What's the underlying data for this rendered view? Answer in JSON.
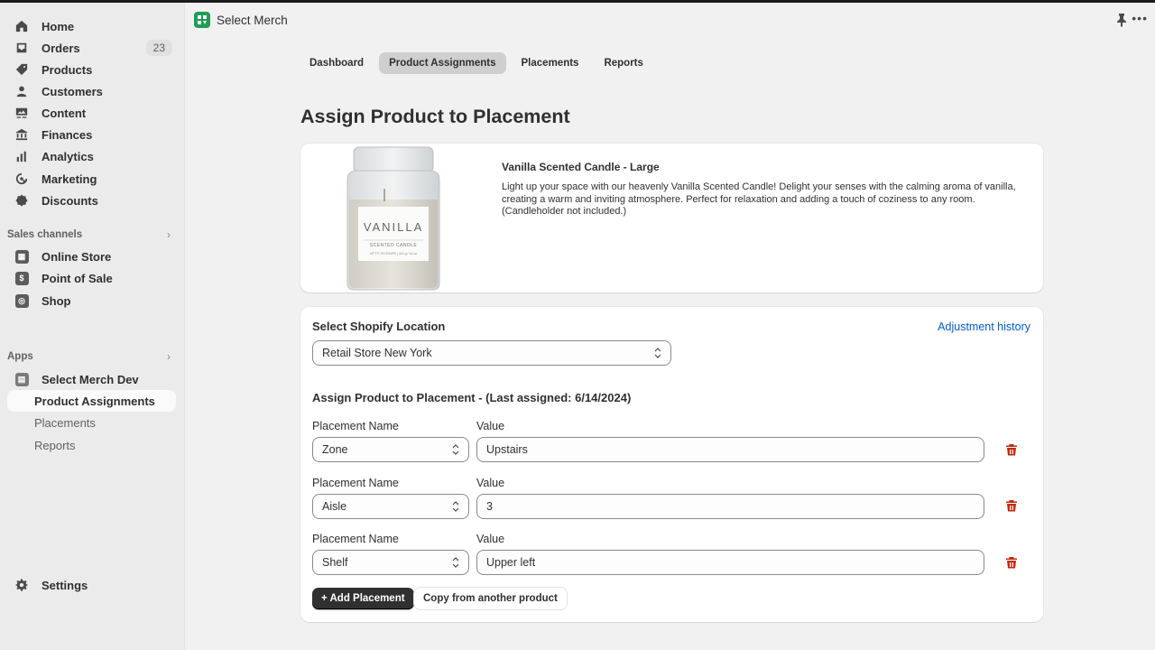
{
  "sidebar": {
    "main_items": [
      {
        "label": "Home",
        "icon": "home-icon"
      },
      {
        "label": "Orders",
        "icon": "inbox-icon",
        "badge": "23"
      },
      {
        "label": "Products",
        "icon": "tag-icon"
      },
      {
        "label": "Customers",
        "icon": "person-icon"
      },
      {
        "label": "Content",
        "icon": "image-icon"
      },
      {
        "label": "Finances",
        "icon": "bank-icon"
      },
      {
        "label": "Analytics",
        "icon": "bar-chart-icon"
      },
      {
        "label": "Marketing",
        "icon": "target-icon"
      },
      {
        "label": "Discounts",
        "icon": "discount-icon"
      }
    ],
    "sales_channels": {
      "heading": "Sales channels",
      "items": [
        {
          "label": "Online Store",
          "icon": "store-icon"
        },
        {
          "label": "Point of Sale",
          "icon": "pos-icon"
        },
        {
          "label": "Shop",
          "icon": "shop-icon"
        }
      ]
    },
    "apps": {
      "heading": "Apps",
      "app_name": "Select Merch Dev",
      "sub_items": [
        {
          "label": "Product Assignments",
          "active": true
        },
        {
          "label": "Placements",
          "active": false
        },
        {
          "label": "Reports",
          "active": false
        }
      ]
    },
    "settings_label": "Settings"
  },
  "header": {
    "app_title": "Select Merch",
    "more_label": "•••"
  },
  "tabs": [
    {
      "label": "Dashboard",
      "active": false
    },
    {
      "label": "Product Assignments",
      "active": true
    },
    {
      "label": "Placements",
      "active": false
    },
    {
      "label": "Reports",
      "active": false
    }
  ],
  "page_title": "Assign Product to Placement",
  "product": {
    "name": "Vanilla Scented Candle - Large",
    "description": "Light up your space with our heavenly Vanilla Scented Candle! Delight your senses with the calming aroma of vanilla, creating a warm and inviting atmosphere. Perfect for relaxation and adding a touch of coziness to any room. (Candleholder not included.)",
    "image_label": "VANILLA",
    "image_sublabel": "SCENTED CANDLE",
    "image_small": "UP TO 75 HOURS | 410 g / 14 oz"
  },
  "form": {
    "location_label": "Select Shopify Location",
    "location_value": "Retail Store New York",
    "history_link": "Adjustment history",
    "assign_heading": "Assign Product to Placement - (Last assigned: 6/14/2024)",
    "placement_name_label": "Placement Name",
    "value_label": "Value",
    "rows": [
      {
        "name": "Zone",
        "value": "Upstairs"
      },
      {
        "name": "Aisle",
        "value": "3"
      },
      {
        "name": "Shelf",
        "value": "Upper left"
      }
    ],
    "add_button": "+ Add Placement",
    "copy_button": "Copy from another product"
  },
  "colors": {
    "accent_link": "#005bd3",
    "delete": "#c5280c",
    "app_logo": "#1f9d55",
    "primary_button": "#303030"
  }
}
